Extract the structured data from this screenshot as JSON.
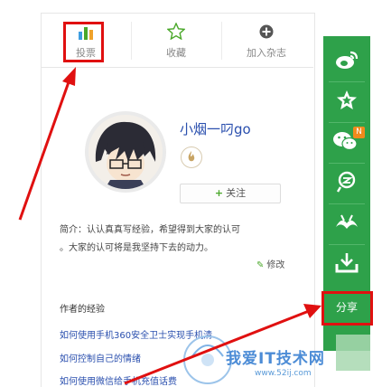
{
  "tabs": [
    {
      "label": "投票",
      "icon": "bar-chart-icon"
    },
    {
      "label": "收藏",
      "icon": "star-outline-icon"
    },
    {
      "label": "加入杂志",
      "icon": "plus-circle-icon"
    }
  ],
  "profile": {
    "username": "小烟一叼go",
    "follow_label": "关注",
    "bio_line1": "简介：认认真真写经验，希望得到大家的认可",
    "bio_line2": "。大家的认可将是我坚持下去的动力。",
    "edit_label": "修改"
  },
  "experiences": {
    "heading": "作者的经验",
    "items": [
      "如何使用手机360安全卫士实现手机清",
      "如何控制自己的情绪",
      "如何使用微信给手机充值话费"
    ]
  },
  "share_bar": {
    "items": [
      "weibo-icon",
      "star-icon",
      "wechat-icon",
      "qzone-icon",
      "renren-icon",
      "download-icon"
    ],
    "wechat_badge": "N",
    "share_label": "分享"
  },
  "watermark": {
    "title": "我爱IT技术网",
    "url": "www.52ij.com"
  },
  "colors": {
    "accent_green": "#2ea14a",
    "annotation_red": "#e01010",
    "link_blue": "#2a4fae"
  }
}
